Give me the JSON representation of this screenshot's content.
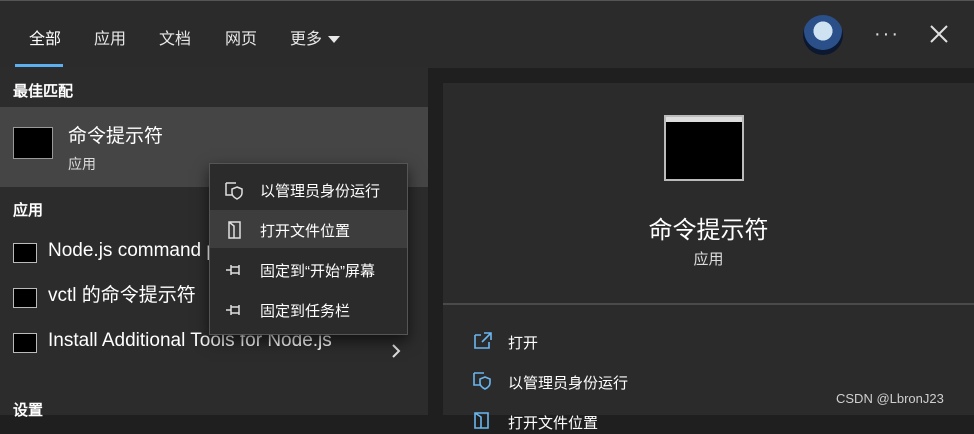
{
  "tabs": [
    {
      "label": "全部"
    },
    {
      "label": "应用"
    },
    {
      "label": "文档"
    },
    {
      "label": "网页"
    },
    {
      "label": "更多"
    }
  ],
  "sections": {
    "best_match": "最佳匹配",
    "apps": "应用",
    "settings": "设置"
  },
  "best_match": {
    "title": "命令提示符",
    "subtitle": "应用"
  },
  "apps": [
    {
      "label": "Node.js command prompt"
    },
    {
      "label": "vctl 的命令提示符"
    },
    {
      "label": "Install Additional Tools for Node.js"
    }
  ],
  "context_menu": [
    {
      "label": "以管理员身份运行",
      "icon": "shield-icon"
    },
    {
      "label": "打开文件位置",
      "icon": "folder-icon"
    },
    {
      "label": "固定到“开始”屏幕",
      "icon": "pin-icon"
    },
    {
      "label": "固定到任务栏",
      "icon": "pin-icon"
    }
  ],
  "detail": {
    "title": "命令提示符",
    "subtitle": "应用",
    "actions": [
      {
        "label": "打开",
        "icon": "open-icon"
      },
      {
        "label": "以管理员身份运行",
        "icon": "shield-icon"
      },
      {
        "label": "打开文件位置",
        "icon": "folder-icon"
      }
    ]
  },
  "watermark": "CSDN @LbronJ23",
  "colors": {
    "accent": "#5db0f0",
    "panel": "#2b2b2b",
    "highlight": "#454545"
  }
}
